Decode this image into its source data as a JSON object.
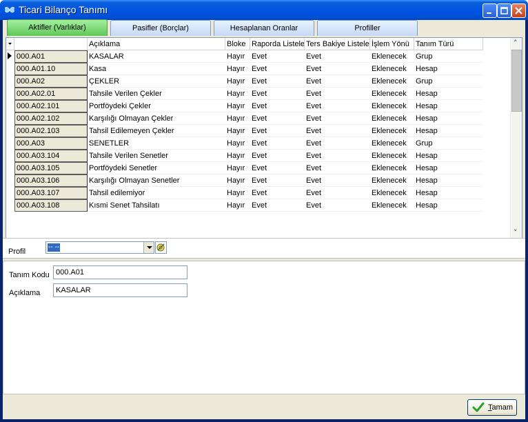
{
  "window": {
    "title": "Ticari Bilanço Tanımı"
  },
  "tabs": [
    {
      "label": "Aktifler (Varlıklar)",
      "active": true
    },
    {
      "label": "Pasifler (Borçlar)",
      "active": false
    },
    {
      "label": "Hesaplanan Oranlar",
      "active": false
    },
    {
      "label": "Profiller",
      "active": false
    }
  ],
  "grid": {
    "columns": [
      "",
      "Açıklama",
      "Bloke",
      "Raporda Listele",
      "Ters Bakiye Listele",
      "İşlem Yönü",
      "Tanım Türü"
    ],
    "rows": [
      {
        "code": "000.A01",
        "aciklama": "KASALAR",
        "bloke": "Hayır",
        "raporda": "Evet",
        "ters": "Evet",
        "islem": "Eklenecek",
        "tur": "Grup"
      },
      {
        "code": "000.A01.10",
        "aciklama": "Kasa",
        "bloke": "Hayır",
        "raporda": "Evet",
        "ters": "Evet",
        "islem": "Eklenecek",
        "tur": "Hesap"
      },
      {
        "code": "000.A02",
        "aciklama": "ÇEKLER",
        "bloke": "Hayır",
        "raporda": "Evet",
        "ters": "Evet",
        "islem": "Eklenecek",
        "tur": "Grup"
      },
      {
        "code": "000.A02.01",
        "aciklama": "Tahsile Verilen Çekler",
        "bloke": "Hayır",
        "raporda": "Evet",
        "ters": "Evet",
        "islem": "Eklenecek",
        "tur": "Hesap"
      },
      {
        "code": "000.A02.101",
        "aciklama": "Portföydeki Çekler",
        "bloke": "Hayır",
        "raporda": "Evet",
        "ters": "Evet",
        "islem": "Eklenecek",
        "tur": "Hesap"
      },
      {
        "code": "000.A02.102",
        "aciklama": "Karşılığı Olmayan Çekler",
        "bloke": "Hayır",
        "raporda": "Evet",
        "ters": "Evet",
        "islem": "Eklenecek",
        "tur": "Hesap"
      },
      {
        "code": "000.A02.103",
        "aciklama": "Tahsil Edilemeyen Çekler",
        "bloke": "Hayır",
        "raporda": "Evet",
        "ters": "Evet",
        "islem": "Eklenecek",
        "tur": "Hesap"
      },
      {
        "code": "000.A03",
        "aciklama": "SENETLER",
        "bloke": "Hayır",
        "raporda": "Evet",
        "ters": "Evet",
        "islem": "Eklenecek",
        "tur": "Grup"
      },
      {
        "code": "000.A03.104",
        "aciklama": "Tahsile Verilen Senetler",
        "bloke": "Hayır",
        "raporda": "Evet",
        "ters": "Evet",
        "islem": "Eklenecek",
        "tur": "Hesap"
      },
      {
        "code": "000.A03.105",
        "aciklama": "Portföydeki Senetler",
        "bloke": "Hayır",
        "raporda": "Evet",
        "ters": "Evet",
        "islem": "Eklenecek",
        "tur": "Hesap"
      },
      {
        "code": "000.A03.106",
        "aciklama": "Karşılığı Olmayan Senetler",
        "bloke": "Hayır",
        "raporda": "Evet",
        "ters": "Evet",
        "islem": "Eklenecek",
        "tur": "Hesap"
      },
      {
        "code": "000.A03.107",
        "aciklama": "Tahsil edilemiyor",
        "bloke": "Hayır",
        "raporda": "Evet",
        "ters": "Evet",
        "islem": "Eklenecek",
        "tur": "Hesap"
      },
      {
        "code": "000.A03.108",
        "aciklama": "Kısmi Senet Tahsilatı",
        "bloke": "Hayır",
        "raporda": "Evet",
        "ters": "Evet",
        "islem": "Eklenecek",
        "tur": "Hesap"
      }
    ]
  },
  "profil": {
    "label": "Profil",
    "value": "-- --"
  },
  "detail": {
    "tanim_kodu_label": "Tanım Kodu",
    "tanim_kodu_value": "000.A01",
    "aciklama_label": "Açıklama",
    "aciklama_value": "KASALAR"
  },
  "footer": {
    "ok_accel": "T",
    "ok_rest": "amam"
  }
}
